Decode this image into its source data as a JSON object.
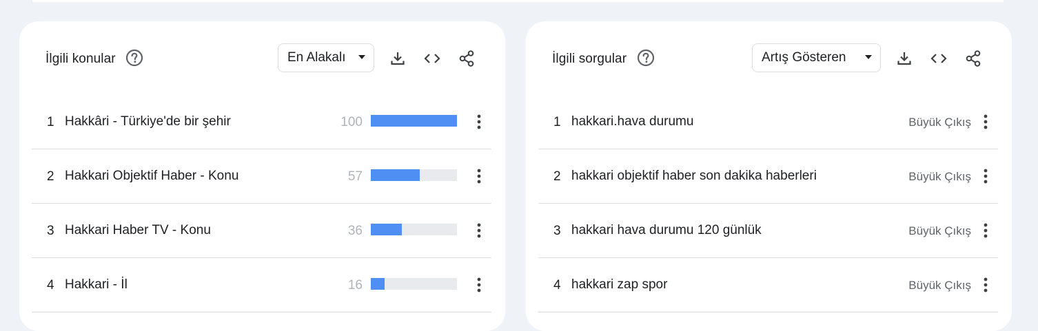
{
  "related_topics": {
    "title": "İlgili konular",
    "help_icon": "help-circle-icon",
    "selector": "En Alakalı",
    "actions": [
      "download-icon",
      "embed-code-icon",
      "share-icon"
    ],
    "rows": [
      {
        "rank": "1",
        "label": "Hakkâri - Türkiye'de bir şehir",
        "value": 100
      },
      {
        "rank": "2",
        "label": "Hakkari Objektif Haber - Konu",
        "value": 57
      },
      {
        "rank": "3",
        "label": "Hakkari Haber TV - Konu",
        "value": 36
      },
      {
        "rank": "4",
        "label": "Hakkari - İl",
        "value": 16
      }
    ]
  },
  "related_queries": {
    "title": "İlgili sorgular",
    "help_icon": "help-circle-icon",
    "selector": "Artış Gösteren",
    "actions": [
      "download-icon",
      "embed-code-icon",
      "share-icon"
    ],
    "rows": [
      {
        "rank": "1",
        "label": "hakkari.hava durumu",
        "status": "Büyük Çıkış"
      },
      {
        "rank": "2",
        "label": "hakkari objektif haber son dakika haberleri",
        "status": "Büyük Çıkış"
      },
      {
        "rank": "3",
        "label": "hakkari hava durumu 120 günlük",
        "status": "Büyük Çıkış"
      },
      {
        "rank": "4",
        "label": "hakkari zap spor",
        "status": "Büyük Çıkış"
      }
    ]
  },
  "colors": {
    "background": "#eff3f8",
    "card": "#ffffff",
    "bar_fill": "#4f8ff3",
    "bar_track": "#e8eaed",
    "value_text": "#b0b3b8",
    "status_text": "#5f6368"
  }
}
